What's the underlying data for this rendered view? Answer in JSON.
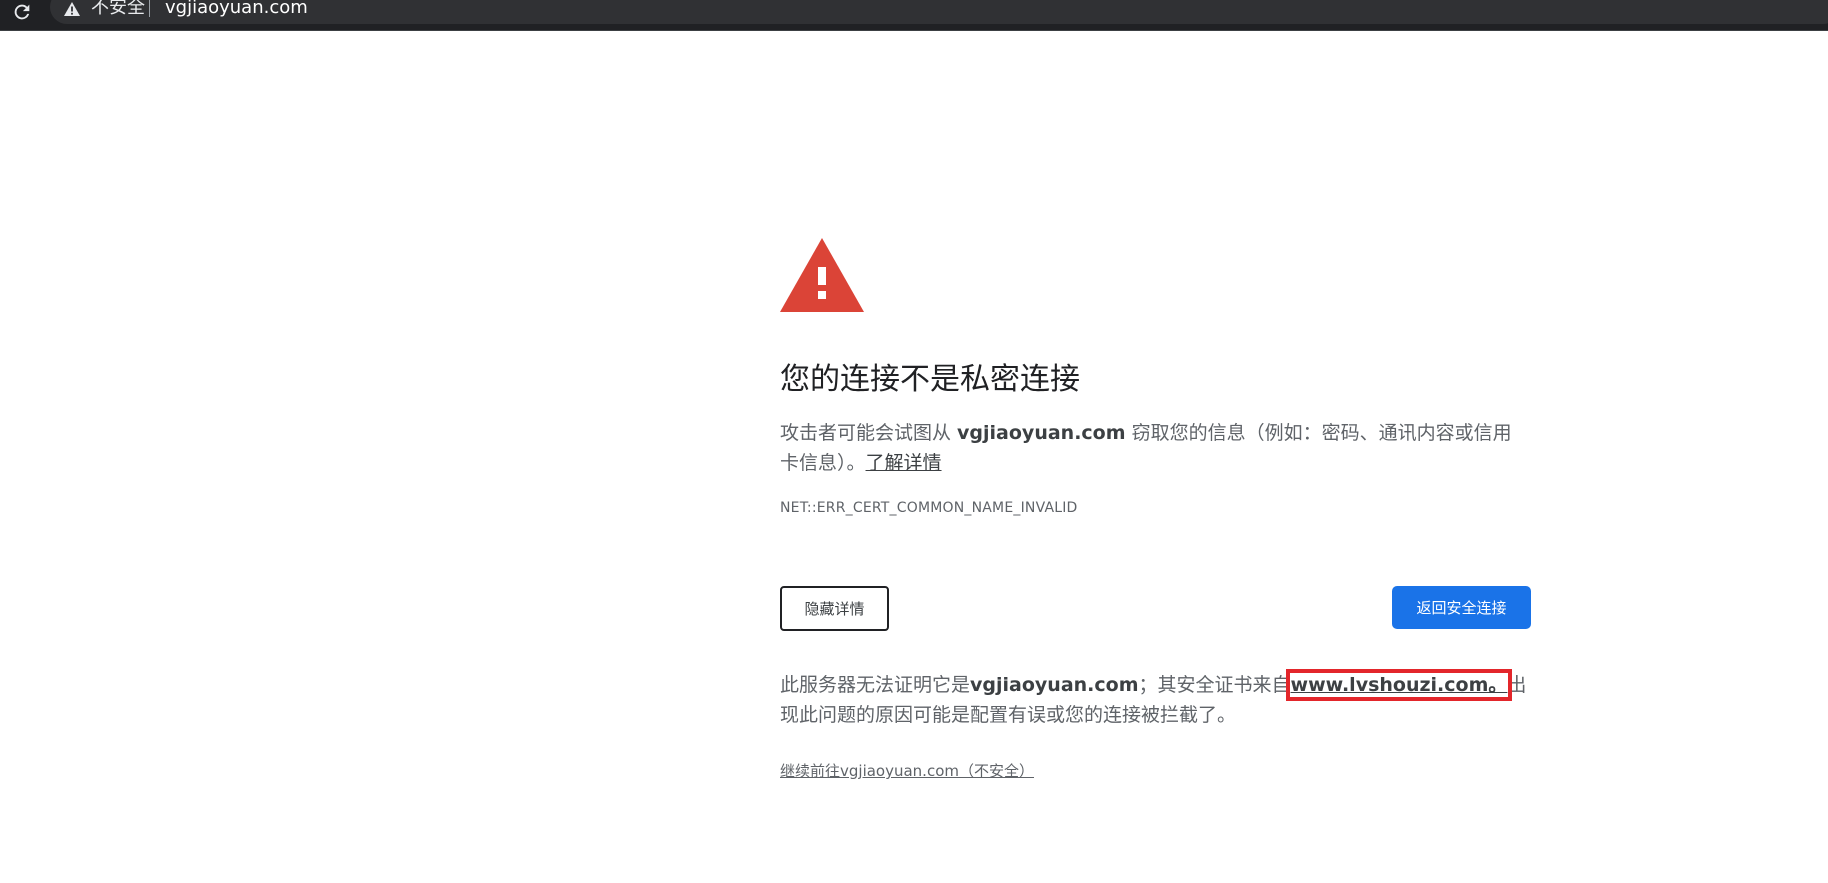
{
  "browser": {
    "security_label": "不安全",
    "url": "vgjiaoyuan.com"
  },
  "colors": {
    "warning_red": "#db4437",
    "primary_blue": "#1a73e8",
    "annotation_red": "#e3262b",
    "toolbar_dark": "#202124"
  },
  "icons": {
    "reload": "reload-icon",
    "address_warning": "warning-triangle-icon",
    "main_warning": "warning-triangle-icon"
  },
  "interstitial": {
    "heading": "您的连接不是私密连接",
    "explanation": {
      "before": "攻击者可能会试图从 ",
      "domain": "vgjiaoyuan.com",
      "after": " 窃取您的信息（例如：密码、通讯内容或信用卡信息）。",
      "learn_more": "了解详情"
    },
    "error_code": "NET::ERR_CERT_COMMON_NAME_INVALID",
    "hide_details_button": "隐藏详情",
    "back_to_safety_button": "返回安全连接",
    "details": {
      "before": "此服务器无法证明它是",
      "domain": "vgjiaoyuan.com",
      "middle": "；其安全证书来自",
      "issuer": "www.lvshouzi.com。",
      "after": "出现此问题的原因可能是配置有误或您的连接被拦截了。"
    },
    "proceed_link": "继续前往vgjiaoyuan.com（不安全）"
  }
}
